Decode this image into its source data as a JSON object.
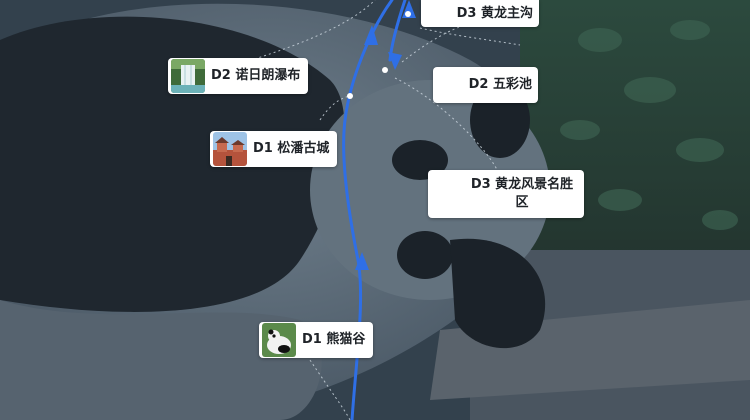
{
  "map": {
    "route_color": "#2f6fe6",
    "stops": [
      {
        "id": "xiongmaogu",
        "label": "D1 熊猫谷",
        "has_thumb": true,
        "thumb_icon": "panda-photo-icon"
      },
      {
        "id": "songpan",
        "label": "D1 松潘古城",
        "has_thumb": true,
        "thumb_icon": "ancient-city-photo-icon"
      },
      {
        "id": "nuorilang",
        "label": "D2 诺日朗瀑布",
        "has_thumb": true,
        "thumb_icon": "waterfall-photo-icon"
      },
      {
        "id": "wucaichi",
        "label": "D2 五彩池",
        "has_thumb": false
      },
      {
        "id": "huanglong_main",
        "label": "D3 黄龙主沟",
        "has_thumb": false
      },
      {
        "id": "huanglong_scenic",
        "label": "D3 黄龙风景名胜区",
        "has_thumb": false
      }
    ]
  }
}
